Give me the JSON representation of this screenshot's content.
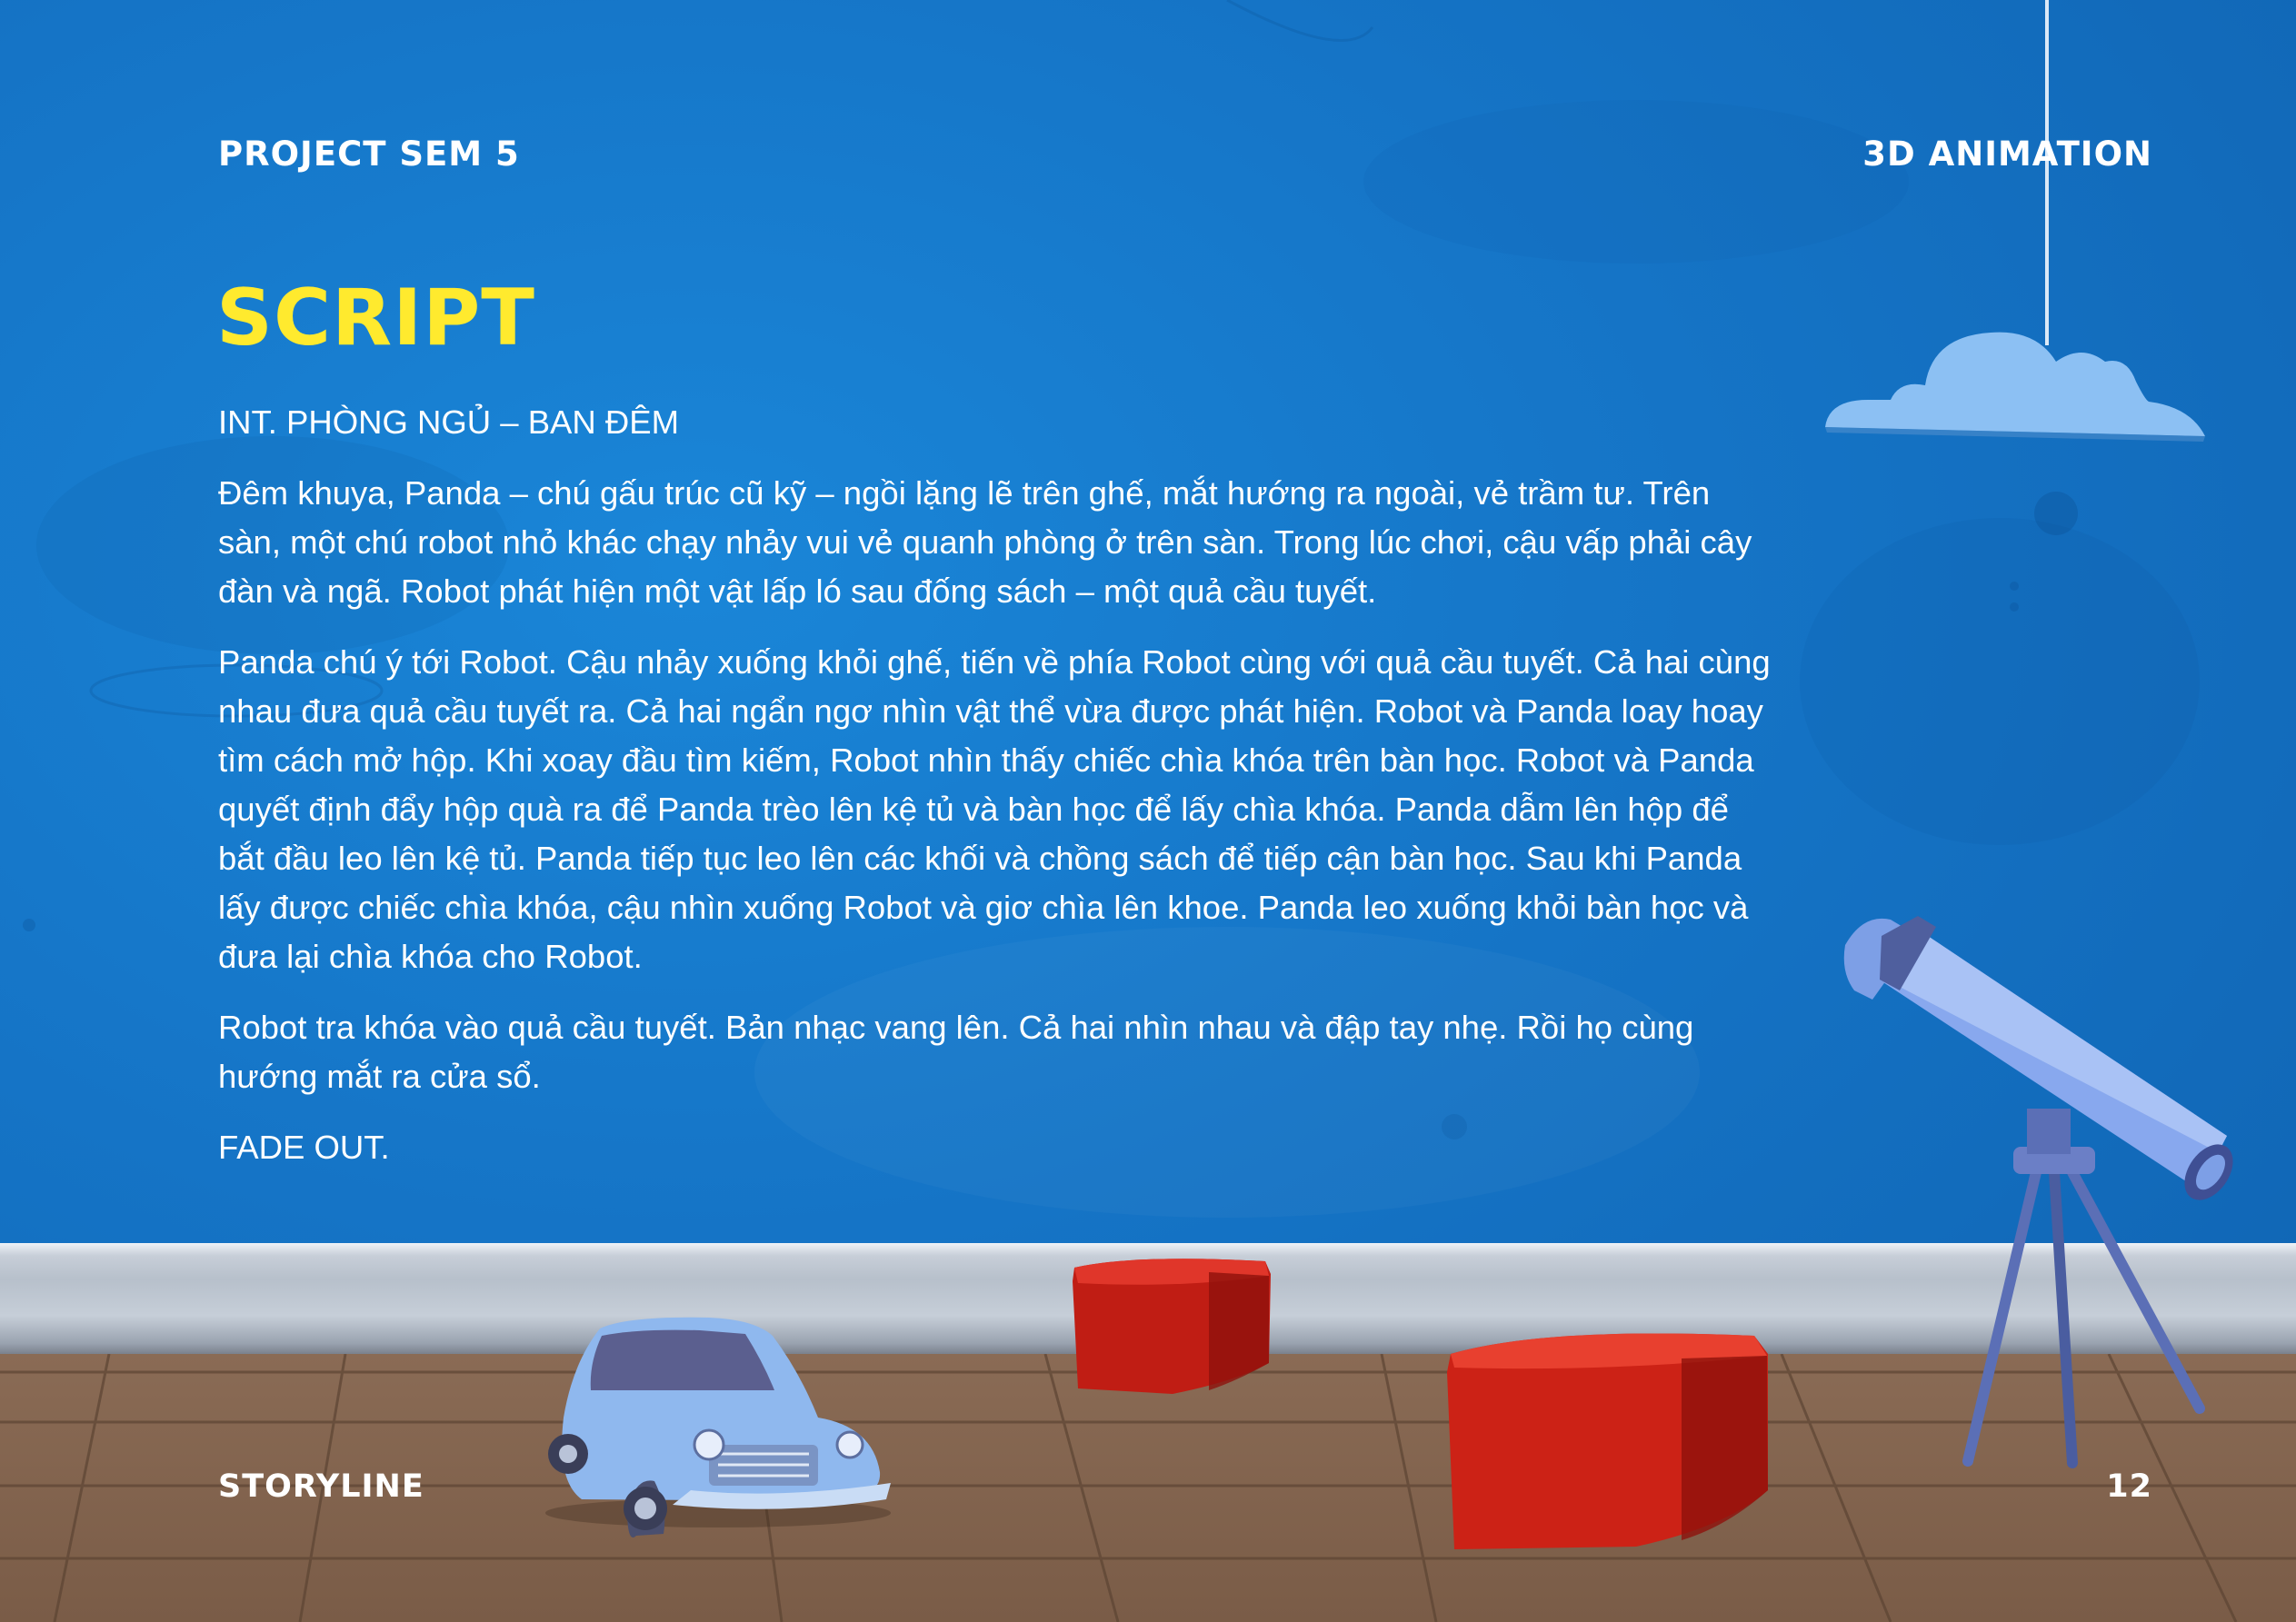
{
  "header": {
    "left": "PROJECT SEM 5",
    "right": "3D ANIMATION"
  },
  "title": "SCRIPT",
  "script": {
    "scene_heading": "INT. PHÒNG NGỦ – BAN ĐÊM",
    "paragraphs": [
      "Đêm khuya, Panda – chú gấu trúc cũ kỹ – ngồi lặng lẽ trên ghế, mắt hướng ra ngoài, vẻ trầm tư. Trên sàn, một chú robot nhỏ khác chạy nhảy vui vẻ quanh phòng ở trên sàn. Trong lúc chơi, cậu vấp phải cây đàn và ngã. Robot phát hiện một vật lấp ló sau đống sách – một quả cầu tuyết.",
      "Panda chú ý tới Robot. Cậu nhảy xuống khỏi ghế, tiến về phía Robot cùng với quả cầu tuyết. Cả hai cùng nhau đưa quả cầu tuyết ra. Cả hai ngẩn ngơ nhìn vật thể vừa được phát hiện. Robot và Panda loay hoay tìm cách mở hộp. Khi xoay đầu tìm kiếm, Robot nhìn thấy chiếc chìa khóa trên bàn học. Robot và Panda quyết định đẩy hộp quà ra để Panda trèo lên kệ tủ và bàn học để lấy chìa khóa. Panda dẫm lên hộp để bắt đầu leo lên kệ tủ. Panda tiếp tục leo lên các khối và chồng sách để tiếp cận bàn học. Sau khi Panda lấy được chiếc chìa khóa, cậu nhìn xuống Robot và giơ chìa lên khoe. Panda leo xuống khỏi bàn học và đưa lại chìa khóa cho Robot.",
      "Robot tra khóa vào quả cầu tuyết. Bản nhạc vang lên. Cả hai nhìn nhau và đập tay nhẹ. Rồi họ cùng hướng mắt ra cửa sổ."
    ],
    "closing": "FADE OUT."
  },
  "footer": {
    "left": "STORYLINE",
    "page_number": "12"
  },
  "colors": {
    "background": "#1574c6",
    "title": "#ffea2e",
    "text": "#ffffff",
    "box_red": "#d42418",
    "car_blue": "#8fb8ee",
    "telescope_blue": "#7d9fe6"
  }
}
